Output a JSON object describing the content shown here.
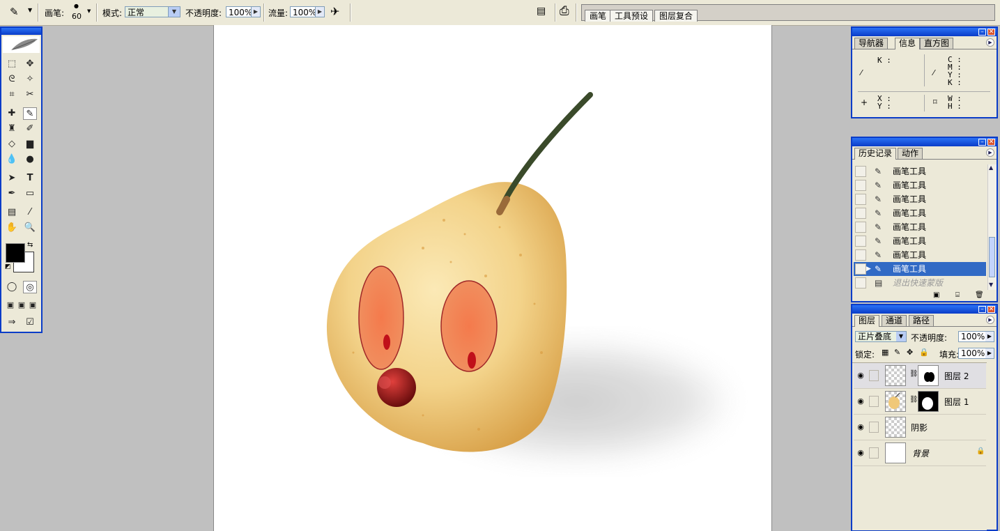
{
  "options_bar": {
    "brush_label": "画笔:",
    "brush_size": "60",
    "mode_label": "模式:",
    "mode_value": "正常",
    "opacity_label": "不透明度:",
    "opacity_value": "100%",
    "flow_label": "流量:",
    "flow_value": "100%",
    "well_tabs": [
      "画笔",
      "工具预设",
      "图层复合"
    ]
  },
  "info_panel": {
    "tabs": [
      "导航器",
      "信息",
      "直方图"
    ],
    "left_channels": "K :",
    "right_channels": [
      "C :",
      "M :",
      "Y :",
      "K :"
    ],
    "xy": [
      "X :",
      "Y :"
    ],
    "wh": [
      "W :",
      "H :"
    ]
  },
  "history_panel": {
    "tabs": [
      "历史记录",
      "动作"
    ],
    "items": [
      {
        "label": "画笔工具"
      },
      {
        "label": "画笔工具"
      },
      {
        "label": "画笔工具"
      },
      {
        "label": "画笔工具"
      },
      {
        "label": "画笔工具"
      },
      {
        "label": "画笔工具"
      },
      {
        "label": "画笔工具"
      },
      {
        "label": "画笔工具"
      },
      {
        "label": "退出快速蒙版"
      }
    ]
  },
  "layers_panel": {
    "tabs": [
      "图层",
      "通道",
      "路径"
    ],
    "blend_mode": "正片叠底",
    "opacity_label": "不透明度:",
    "opacity_value": "100%",
    "lock_label": "锁定:",
    "fill_label": "填充:",
    "fill_value": "100%",
    "layers": [
      {
        "name": "图层 2"
      },
      {
        "name": "图层 1"
      },
      {
        "name": "阴影"
      },
      {
        "name": "背景"
      }
    ]
  },
  "colors": {
    "panel_border": "#0a3cc8",
    "selection": "#316ac5",
    "ui_bg": "#ece9d8"
  }
}
